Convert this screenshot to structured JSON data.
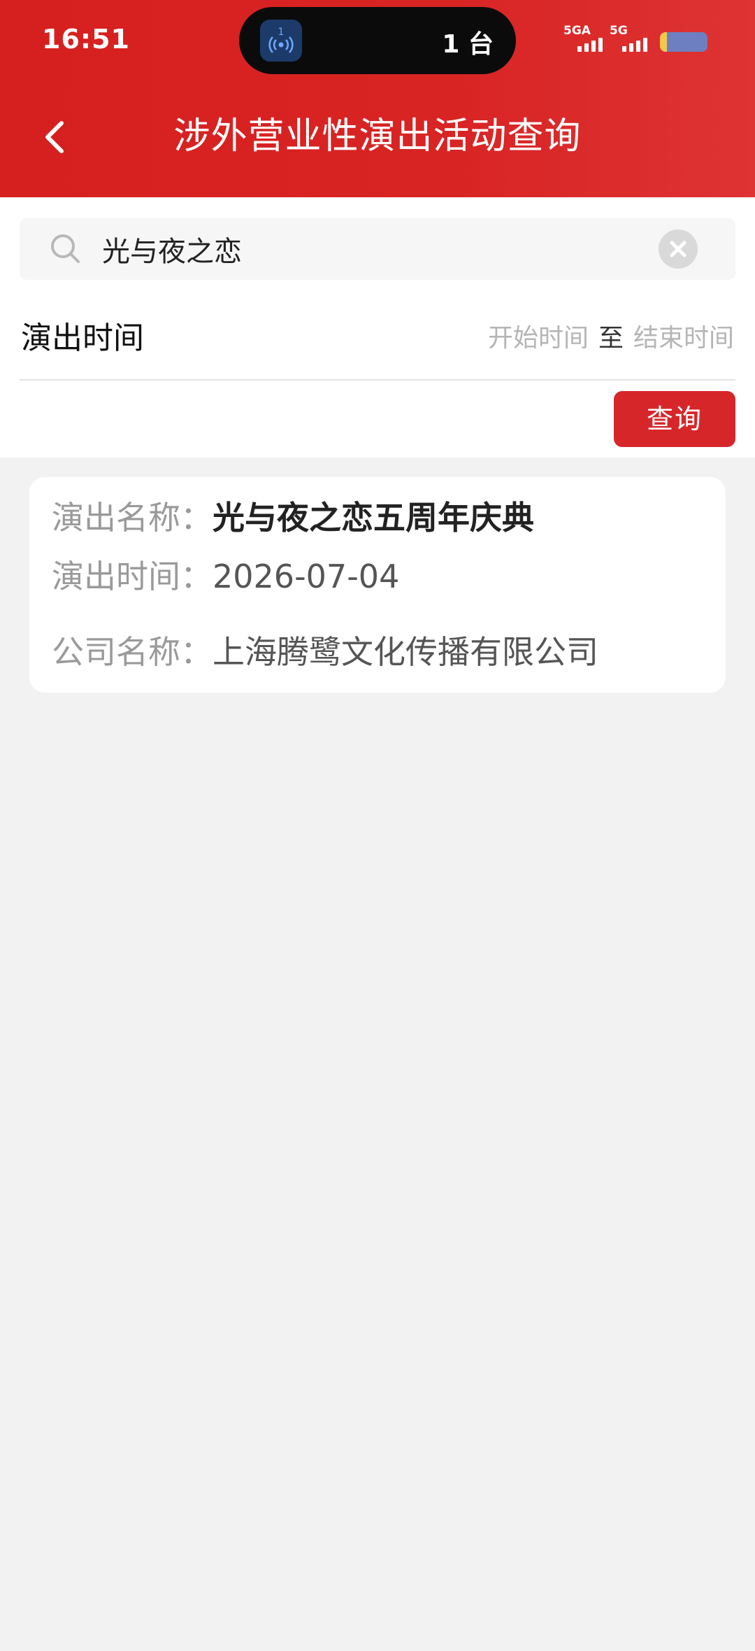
{
  "status_bar": {
    "time": "16:51",
    "island_badge": "1",
    "island_text": "1 台",
    "network1": "5GA",
    "network2": "5G"
  },
  "header": {
    "title": "涉外营业性演出活动查询"
  },
  "search": {
    "value": "光与夜之恋"
  },
  "filter": {
    "date_label": "演出时间",
    "start_placeholder": "开始时间",
    "separator": "至",
    "end_placeholder": "结束时间",
    "query_button": "查询"
  },
  "results": [
    {
      "name_label": "演出名称：",
      "name": "光与夜之恋五周年庆典",
      "time_label": "演出时间：",
      "time": "2026-07-04",
      "company_label": "公司名称：",
      "company": "上海腾鹭文化传播有限公司"
    }
  ],
  "colors": {
    "header_red": "#d6201f",
    "button_red": "#d7262a",
    "background": "#f2f2f2"
  }
}
